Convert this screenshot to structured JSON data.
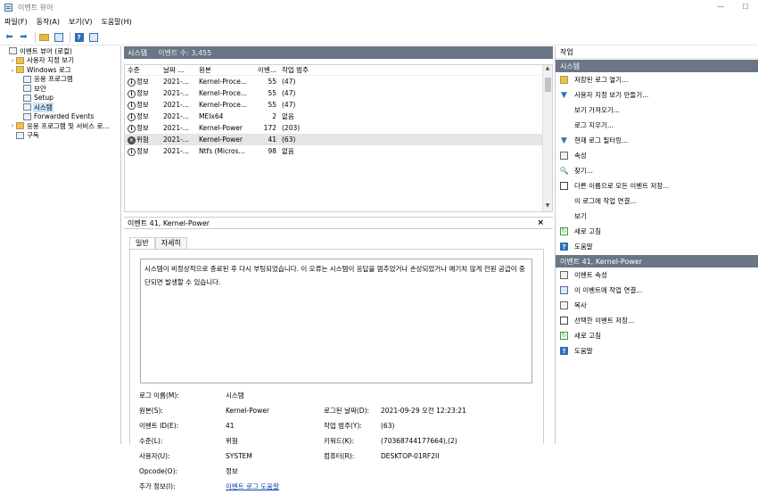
{
  "window": {
    "title": "이벤트 뷰어",
    "minimize": "—",
    "maximize": "☐"
  },
  "menu": [
    "파일(F)",
    "동작(A)",
    "보기(V)",
    "도움말(H)"
  ],
  "tree": {
    "items": [
      {
        "label": "이벤트 뷰어 (로컬)",
        "expander": "",
        "indent": 0,
        "icon": "event-viewer-icon"
      },
      {
        "label": "사용자 지정 보기",
        "expander": "›",
        "indent": 1,
        "icon": "folder-icon"
      },
      {
        "label": "Windows 로그",
        "expander": "⌄",
        "indent": 1,
        "icon": "folder-icon"
      },
      {
        "label": "응용 프로그램",
        "expander": "",
        "indent": 2,
        "icon": "log-icon"
      },
      {
        "label": "보안",
        "expander": "",
        "indent": 2,
        "icon": "log-icon"
      },
      {
        "label": "Setup",
        "expander": "",
        "indent": 2,
        "icon": "log-icon"
      },
      {
        "label": "시스템",
        "expander": "",
        "indent": 2,
        "icon": "log-icon",
        "selected": true
      },
      {
        "label": "Forwarded Events",
        "expander": "",
        "indent": 2,
        "icon": "log-icon"
      },
      {
        "label": "응용 프로그램 및 서비스 로...",
        "expander": "›",
        "indent": 1,
        "icon": "folder-icon"
      },
      {
        "label": "구독",
        "expander": "",
        "indent": 1,
        "icon": "subscription-icon"
      }
    ]
  },
  "center": {
    "header_title": "시스템",
    "header_count": "이벤트 수: 3,455",
    "columns": [
      "수준",
      "날짜 ...",
      "원본",
      "이벤...",
      "작업 범주"
    ],
    "rows": [
      {
        "level": "정보",
        "icon": "i",
        "date": "2021-...",
        "source": "Kernel-Proce...",
        "id": "55",
        "category": "(47)"
      },
      {
        "level": "정보",
        "icon": "i",
        "date": "2021-...",
        "source": "Kernel-Proce...",
        "id": "55",
        "category": "(47)"
      },
      {
        "level": "정보",
        "icon": "i",
        "date": "2021-...",
        "source": "Kernel-Proce...",
        "id": "55",
        "category": "(47)"
      },
      {
        "level": "정보",
        "icon": "i",
        "date": "2021-...",
        "source": "MEIx64",
        "id": "2",
        "category": "없음"
      },
      {
        "level": "정보",
        "icon": "i",
        "date": "2021-...",
        "source": "Kernel-Power",
        "id": "172",
        "category": "(203)"
      },
      {
        "level": "위험",
        "icon": "✕",
        "date": "2021-...",
        "source": "Kernel-Power",
        "id": "41",
        "category": "(63)",
        "selected": true
      },
      {
        "level": "정보",
        "icon": "i",
        "date": "2021-...",
        "source": "Ntfs (Micros...",
        "id": "98",
        "category": "없음"
      }
    ],
    "detail_title": "이벤트 41, Kernel-Power",
    "close": "×",
    "tabs": [
      "일반",
      "자세히"
    ],
    "description": "시스템이 비정상적으로 종료된 후 다시 부팅되었습니다. 이 오류는 시스템이 응답을 멈추었거나 손상되었거나 예기치 않게 전원 공급이 중단되면 발생할 수 있습니다.",
    "props": {
      "log_name_label": "로그 이름(M):",
      "log_name": "시스템",
      "source_label": "원본(S):",
      "source": "Kernel-Power",
      "logged_label": "로그된 날짜(D):",
      "logged": "2021-09-29 오전 12:23:21",
      "event_id_label": "이벤트 ID(E):",
      "event_id": "41",
      "task_label": "작업 범주(Y):",
      "task": "(63)",
      "level_label": "수준(L):",
      "level": "위험",
      "keywords_label": "키워드(K):",
      "keywords": "(70368744177664),(2)",
      "user_label": "사용자(U):",
      "user": "SYSTEM",
      "computer_label": "컴퓨터(R):",
      "computer": "DESKTOP-01RF2II",
      "opcode_label": "Opcode(O):",
      "opcode": "정보",
      "more_label": "추가 정보(I):",
      "more": "이벤트 로그 도움말"
    }
  },
  "actions": {
    "title": "작업",
    "section1": "시스템",
    "items1": [
      {
        "label": "저장된 로그 열기...",
        "icon": "open-icon"
      },
      {
        "label": "사용자 지정 보기 만들기...",
        "icon": "filter-icon"
      },
      {
        "label": "보기 가져오기...",
        "icon": "none"
      },
      {
        "label": "로그 지우기...",
        "icon": "none"
      },
      {
        "label": "현재 로그 필터링...",
        "icon": "filter-icon"
      },
      {
        "label": "속성",
        "icon": "properties-icon"
      },
      {
        "label": "찾기...",
        "icon": "find-icon"
      },
      {
        "label": "다른 이름으로 모든 이벤트 저장...",
        "icon": "save-icon"
      },
      {
        "label": "이 로그에 작업 연결...",
        "icon": "none"
      },
      {
        "label": "보기",
        "icon": "none"
      },
      {
        "label": "새로 고침",
        "icon": "refresh-icon"
      },
      {
        "label": "도움말",
        "icon": "help-icon"
      }
    ],
    "section2": "이벤트 41, Kernel-Power",
    "items2": [
      {
        "label": "이벤트 속성",
        "icon": "properties-icon"
      },
      {
        "label": "이 이벤트에 작업 연결...",
        "icon": "task-icon"
      },
      {
        "label": "복사",
        "icon": "copy-icon"
      },
      {
        "label": "선택한 이벤트 저장...",
        "icon": "save-icon"
      },
      {
        "label": "새로 고침",
        "icon": "refresh-icon"
      },
      {
        "label": "도움말",
        "icon": "help-icon"
      }
    ]
  }
}
